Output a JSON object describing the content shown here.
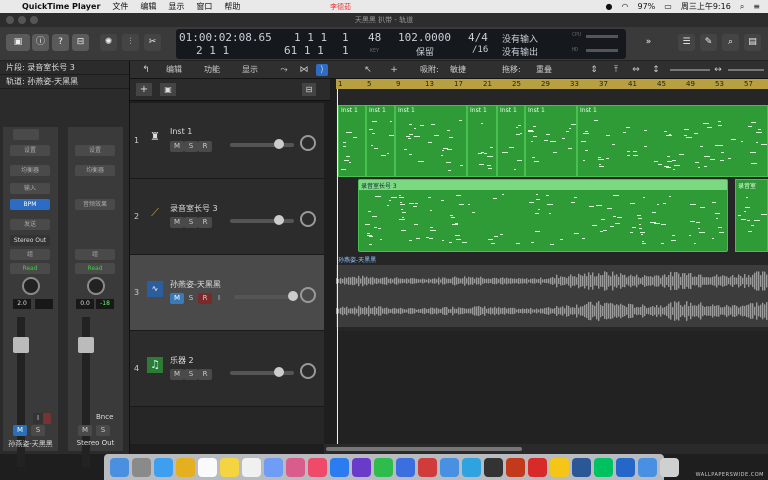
{
  "menubar": {
    "app": "QuickTime Player",
    "items": [
      "文件",
      "编辑",
      "显示",
      "窗口",
      "帮助"
    ],
    "battery": "97%",
    "clock": "周三上午9:16"
  },
  "window": {
    "title": "天黑黑 扒带 - 轨道",
    "recorder": "李德茹"
  },
  "lcd": {
    "time": "01:00:02:08.65",
    "smpte_sub": "1  1  1",
    "smpte_sub2": "1",
    "bars": "2  1  1",
    "bars_sub": "61  1  1",
    "bars_sub2": "1",
    "tempo": "102.0000",
    "tempo_mode": "保留",
    "tempo_sub": "48",
    "time_sig": "4/4",
    "division": "/16",
    "in_status": "没有输入",
    "out_status": "没有输出",
    "key_label": "KEY",
    "cpu_label": "CPU",
    "hd_label": "HD"
  },
  "inspector": {
    "region_label": "片段: 录音室长号 3",
    "track_label": "轨道: 孙燕姿-天黑黑",
    "left_strip": {
      "setting": "设置",
      "eq": "均衡器",
      "input": "输入",
      "bpm": "BPM",
      "send": "发送",
      "output": "Stereo Out",
      "group": "组",
      "automation": "Read",
      "volume": "2.0",
      "name": "孙燕姿-天黑黑"
    },
    "right_strip": {
      "setting": "设置",
      "eq": "均衡器",
      "fx": "音频效果",
      "group": "组",
      "automation": "Read",
      "volume": "0.0",
      "peak": "-18",
      "output": "Bnce",
      "name": "Stereo Out"
    },
    "mute": "M",
    "solo": "S",
    "insert": "I"
  },
  "controlbar": {
    "edit": "编辑",
    "function": "功能",
    "view": "显示",
    "snap_label": "吸附:",
    "snap_value": "敏捷",
    "drag_label": "拖移:",
    "drag_value": "重叠"
  },
  "ruler": {
    "marks": [
      "1",
      "5",
      "9",
      "13",
      "17",
      "21",
      "25",
      "29",
      "33",
      "37",
      "41",
      "45",
      "49",
      "53",
      "57"
    ]
  },
  "tracks": [
    {
      "num": "1",
      "name": "Inst 1",
      "icon": "piano-icon",
      "m": "M",
      "s": "S",
      "r": "R"
    },
    {
      "num": "2",
      "name": "录音室长号 3",
      "icon": "trombone-icon",
      "m": "M",
      "s": "S",
      "r": "R"
    },
    {
      "num": "3",
      "name": "孙燕姿-天黑黑",
      "icon": "waveform-icon",
      "m": "M",
      "s": "S",
      "r": "R",
      "i": "I"
    },
    {
      "num": "4",
      "name": "乐器 2",
      "icon": "music-note-icon",
      "m": "M",
      "s": "S",
      "r": "R"
    }
  ],
  "regions": {
    "inst": [
      "Inst 1",
      "Inst 1",
      "Inst 1",
      "Inst 1",
      "Inst 1",
      "Inst 1",
      "Inst 1"
    ],
    "trombone": "录音室长号 3",
    "trombone2": "录音室",
    "audio": "孙燕姿-天黑黑"
  },
  "dock": {
    "icons": [
      "finder-icon",
      "launchpad-icon",
      "safari-icon",
      "chrome-icon",
      "calendar-icon",
      "notes-icon",
      "reminders-icon",
      "app-icon",
      "photos-icon",
      "music-icon",
      "appstore-icon",
      "imovie-icon",
      "wechat-icon",
      "baidu-icon",
      "ladybug-icon",
      "preview-icon",
      "telegram-icon",
      "game-icon",
      "fontbook-icon",
      "netease-music-icon",
      "qq-icon",
      "word-icon",
      "iqiyi-icon",
      "edge-icon",
      "downloads-icon",
      "trash-icon"
    ]
  },
  "watermark": "WALLPAPERSWIDE.COM"
}
